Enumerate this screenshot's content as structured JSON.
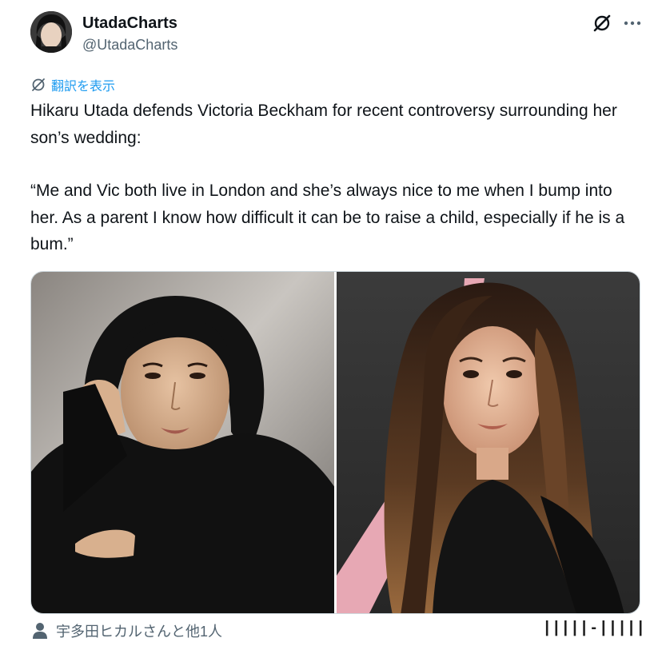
{
  "account": {
    "display_name": "UtadaCharts",
    "handle": "@UtadaCharts"
  },
  "header_icons": {
    "grok": "grok-icon",
    "more": "more-icon"
  },
  "translate": {
    "label": "翻訳を表示",
    "icon": "translate-icon"
  },
  "tweet": {
    "paragraphs": [
      "Hikaru Utada defends Victoria Beckham for recent controversy surrounding her son’s wedding:",
      "“Me and Vic both live in London and she’s always nice to me when I bump into her. As a parent I know how difficult it can be to raise a child, especially if he is a bum.”"
    ]
  },
  "media": {
    "photos": [
      "portrait-photo-left",
      "portrait-photo-right"
    ]
  },
  "tagged": {
    "label": "宇多田ヒカルさんと他1人",
    "icon": "person-icon"
  },
  "watermark": {
    "text": "| | | | | ‐ | | | | |"
  },
  "colors": {
    "link": "#1d9bf0",
    "secondary_text": "#536471",
    "primary_text": "#0f1419"
  }
}
